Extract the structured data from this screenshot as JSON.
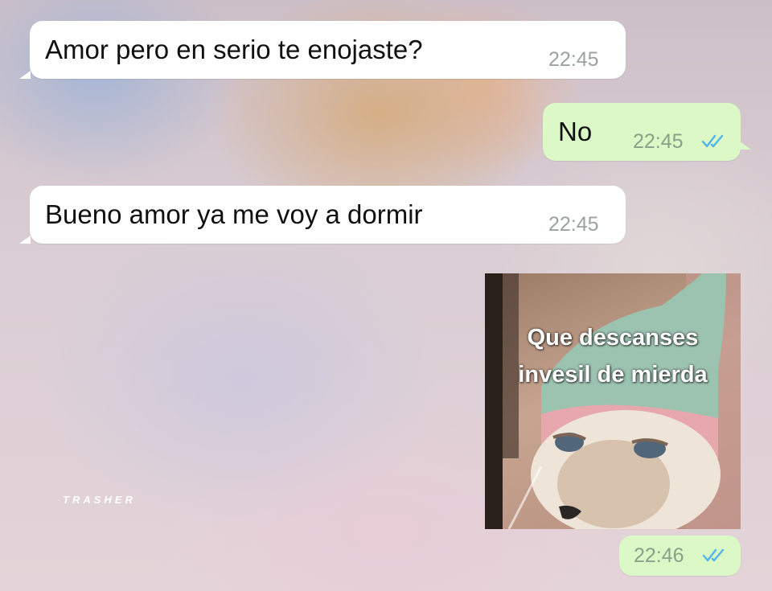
{
  "chat": {
    "messages": [
      {
        "direction": "incoming",
        "text": "Amor pero en serio te enojaste?",
        "time": "22:45"
      },
      {
        "direction": "outgoing",
        "text": "No",
        "time": "22:45",
        "status": "read-double-check-icon"
      },
      {
        "direction": "incoming",
        "text": "Bueno amor ya me voy a dormir",
        "time": "22:45"
      },
      {
        "direction": "outgoing",
        "type": "sticker",
        "sticker_caption_line1": "Que descanses",
        "sticker_caption_line2": "invesil de mierda",
        "sticker_icon": "sleepy-cat-in-pink-hat",
        "time": "22:46",
        "status": "read-double-check-icon"
      }
    ]
  },
  "watermark": "TRASHER",
  "colors": {
    "incoming_bubble": "#ffffff",
    "outgoing_bubble": "#dcf8c6",
    "read_ticks": "#4fb6ec",
    "timestamp": "#9aa3a0"
  }
}
